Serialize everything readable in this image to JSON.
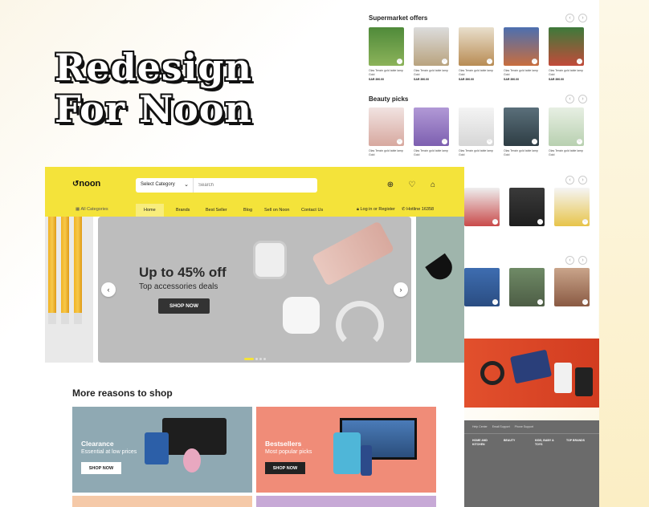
{
  "title": {
    "line1": "Redesign",
    "line2": "For Noon"
  },
  "header": {
    "logo": "noon",
    "category_select": "Select Category",
    "search_placeholder": "Search"
  },
  "nav": {
    "all_categories": "All Categories",
    "tabs": [
      "Home",
      "Brands",
      "Best Seller",
      "Blog",
      "Sell on Noon",
      "Contact Us"
    ],
    "login": "Log in or Register",
    "hotline": "Hotline 16358"
  },
  "hero": {
    "headline": "Up to 45% off",
    "subline": "Top accessories deals",
    "cta": "SHOP NOW"
  },
  "more_reasons": {
    "title": "More reasons to shop",
    "cards": [
      {
        "title": "Clearance",
        "subtitle": "Essential at low prices",
        "cta": "SHOP NOW",
        "bg": "#8fa9b3"
      },
      {
        "title": "Bestsellers",
        "subtitle": "Most popular picks",
        "cta": "SHOP NOW",
        "bg": "#f08c78"
      }
    ]
  },
  "right_page": {
    "sections": [
      "Supermarket offers",
      "Beauty picks"
    ],
    "product_text": "Olas Tenzin gold table lamp Gold",
    "product_price": "SAR 390.00"
  },
  "footer": {
    "top": [
      "Help Center",
      "Email Support",
      "Phone Support"
    ],
    "columns": [
      "HOME AND KITCHEN",
      "BEAUTY",
      "KIDS, BABY & TOYS",
      "TOP BRANDS"
    ]
  },
  "colors": {
    "brand_yellow": "#f4e33a",
    "cta_dark": "#333333",
    "promo_red": "#e2502d"
  }
}
